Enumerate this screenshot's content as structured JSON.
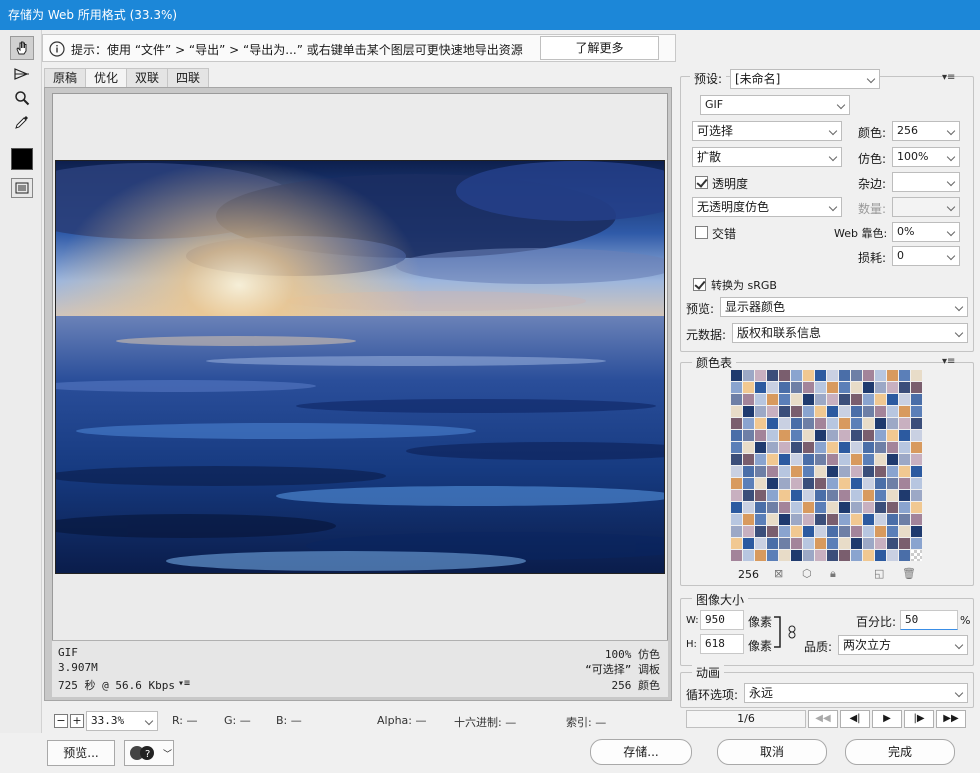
{
  "window": {
    "title": "存储为 Web 所用格式 (33.3%)"
  },
  "hint": {
    "text": "提示：使用 “文件” > “导出” > “导出为...” 或右键单击某个图层可更快速地导出资源",
    "learn_more": "了解更多"
  },
  "tabs": [
    "原稿",
    "优化",
    "双联",
    "四联"
  ],
  "active_tab": 1,
  "image_info": {
    "format": "GIF",
    "size": "3.907M",
    "time": "725 秒 @ 56.6 Kbps",
    "dither": "100% 仿色",
    "palette": "“可选择” 调板",
    "colors": "256 颜色"
  },
  "status": {
    "zoom": "33.3%",
    "r": "R: —",
    "g": "G: —",
    "b": "B: —",
    "alpha": "Alpha: —",
    "hex": "十六进制: —",
    "index": "索引: —"
  },
  "settings": {
    "preset_label": "预设:",
    "preset_value": "[未命名]",
    "format_value": "GIF",
    "reduction": "可选择",
    "colors_label": "颜色:",
    "colors_value": "256",
    "dither_algo": "扩散",
    "dither_label": "仿色:",
    "dither_value": "100%",
    "transparency_label": "透明度",
    "transparency_checked": true,
    "matte_label": "杂边:",
    "matte_value": "",
    "trans_dither": "无透明度仿色",
    "amount_label": "数量:",
    "interlaced_label": "交错",
    "interlaced_checked": false,
    "websnap_label": "Web 靠色:",
    "websnap_value": "0%",
    "lossy_label": "损耗:",
    "lossy_value": "0",
    "srgb_label": "转换为 sRGB",
    "srgb_checked": true,
    "preview_label": "预览:",
    "preview_value": "显示器颜色",
    "metadata_label": "元数据:",
    "metadata_value": "版权和联系信息"
  },
  "color_table": {
    "title": "颜色表",
    "count": "256",
    "colors": [
      "#1f3a6e",
      "#2c5aa0",
      "#5b7fb8",
      "#8aa4cf",
      "#b7c6e0",
      "#3b4e7a",
      "#6e7fa6",
      "#9ca8c6",
      "#c9d0e2",
      "#e8dcc8",
      "#f1c891",
      "#d89a5e",
      "#7a5e6e",
      "#a3849a",
      "#c8b0c0",
      "#4a6ea8"
    ]
  },
  "image_size": {
    "title": "图像大小",
    "w_label": "W:",
    "w_value": "950",
    "w_unit": "像素",
    "h_label": "H:",
    "h_value": "618",
    "h_unit": "像素",
    "percent_label": "百分比:",
    "percent_value": "50",
    "percent_unit": "%",
    "quality_label": "品质:",
    "quality_value": "两次立方"
  },
  "animation": {
    "title": "动画",
    "loop_label": "循环选项:",
    "loop_value": "永远",
    "frame": "1/6"
  },
  "buttons": {
    "preview": "预览...",
    "save": "存储...",
    "cancel": "取消",
    "done": "完成"
  }
}
